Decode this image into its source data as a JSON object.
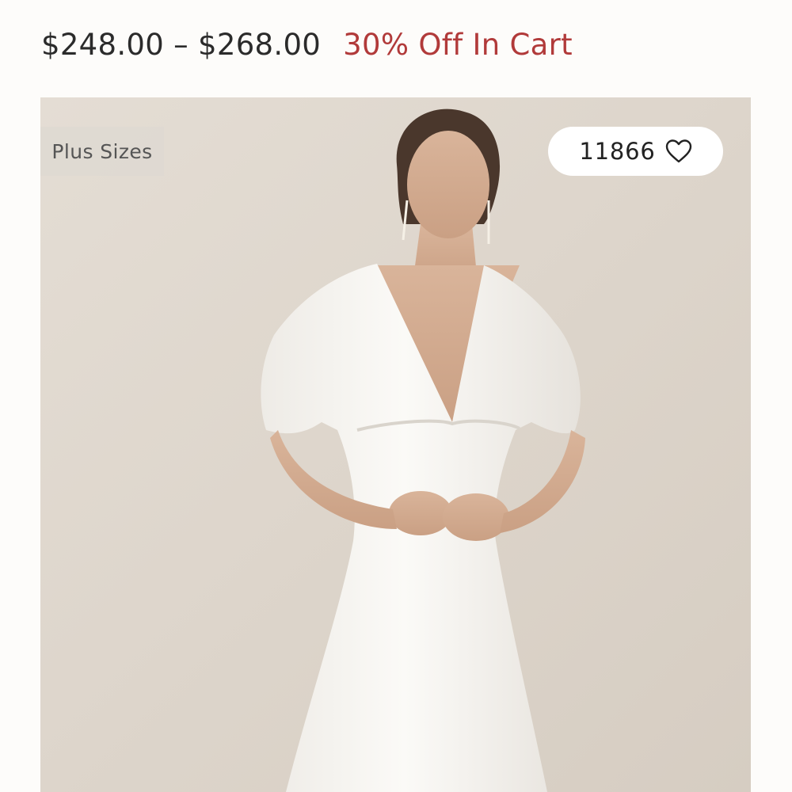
{
  "product": {
    "price_range": "$248.00 – $268.00",
    "promo_text": "30% Off In Cart",
    "badge": "Plus Sizes",
    "favorites_count": "11866",
    "favorite_icon": "heart-outline-icon",
    "image_description": "Model wearing a white satin V-neck midi dress with flutter sleeves"
  },
  "colors": {
    "price": "#2b2b2b",
    "promo": "#b13a3a",
    "image_background": "#ddd5cc"
  }
}
